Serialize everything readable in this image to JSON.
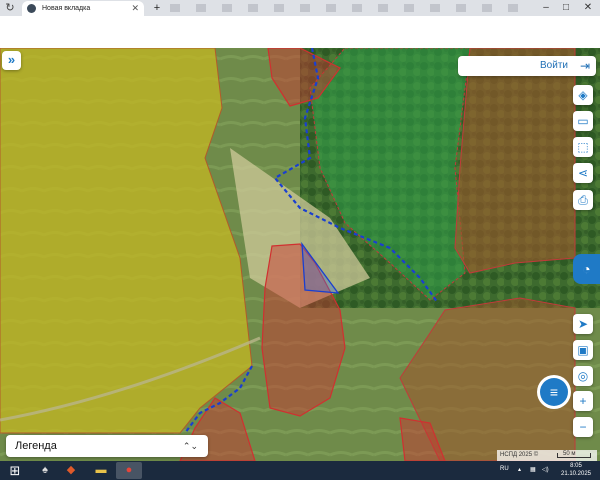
{
  "browser": {
    "tabs": [
      {
        "label": "Новая вкладка",
        "active": true
      },
      {
        "label": "+",
        "active": false
      }
    ],
    "nav": {
      "back_icon": "back-arrow-icon",
      "tab_icon": "browser-tab-icon"
    },
    "window_controls": {
      "minimize": "–",
      "maximize": "□",
      "close": "✕"
    }
  },
  "map": {
    "expand_label": "»",
    "login_label": "Войти",
    "login_icon": "sign-in-icon",
    "toolbar_icons": [
      "layers-icon",
      "ruler-icon",
      "select-area-icon",
      "share-icon",
      "print-icon"
    ],
    "panel_toggle_icon": "cadastre-logo-icon",
    "nav_icons": [
      "locate-arrow-icon",
      "map-mode-icon",
      "search-location-icon",
      "zoom-in-icon",
      "zoom-out-icon"
    ],
    "zoom_in_label": "+",
    "zoom_out_label": "−",
    "menu_icon": "menu-lines-icon",
    "legend_label": "Легенда",
    "attribution": "НСПД 2025 ©",
    "scale_label": "50 м",
    "colors": {
      "yellow_zone": "#c8b820",
      "green_zone": "#2fa04a",
      "brown_zone": "#a0562c",
      "red_parcel": "#d03030",
      "blue_border": "#1a3fd0",
      "accent": "#1f7ac6"
    }
  },
  "taskbar": {
    "language": "RU",
    "time": "8:05",
    "date": "21.10.2025",
    "apps": [
      "start-orb-icon",
      "folder-icon",
      "media-icon",
      "explorer-icon",
      "chrome-icon"
    ]
  }
}
